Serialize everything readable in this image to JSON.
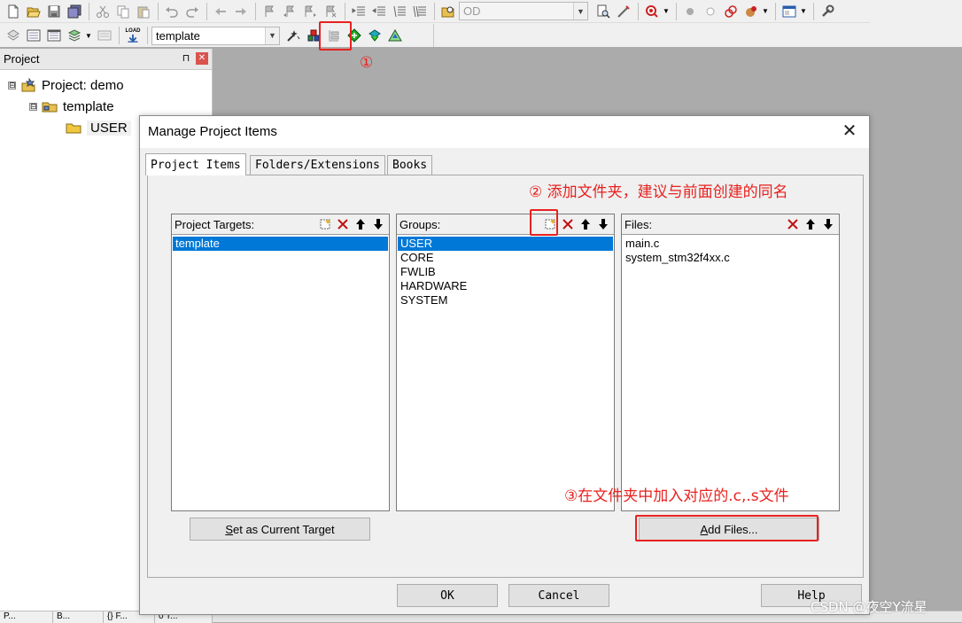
{
  "toolbar": {
    "row1_icons": [
      "new-file-icon",
      "open-folder-icon",
      "save-icon",
      "save-all-icon",
      "cut-icon",
      "copy-icon",
      "paste-icon",
      "undo-icon",
      "redo-icon",
      "nav-back-icon",
      "nav-forward-icon",
      "bookmark-icon",
      "bookmark-prev-icon",
      "bookmark-next-icon",
      "bookmark-clear-icon",
      "indent-icon",
      "unindent-icon",
      "comment-icon",
      "uncomment-icon",
      "find-in-files-icon"
    ],
    "find_combo_value": "OD",
    "row1_right_icons": [
      "find-icon",
      "incremental-find-icon",
      "debug-session-icon",
      "breakpoint-icon",
      "breakpoint-disable-icon",
      "breakpoint-clear-icon",
      "breakpoint-kill-icon",
      "window-layout-icon",
      "configure-icon"
    ],
    "row2_icons": [
      "translate-icon",
      "build-icon",
      "rebuild-icon",
      "batch-build-icon",
      "stop-build-icon",
      "download-icon"
    ],
    "download_label": "LOAD",
    "target_combo_value": "template",
    "row2_right_icons": [
      "target-options-icon",
      "manage-project-items-icon",
      "file-extensions-icon",
      "manage-run-time-icon",
      "select-software-packs-icon",
      "pack-installer-icon"
    ]
  },
  "project_panel": {
    "title": "Project",
    "pin_glyph": "⊓",
    "close_glyph": "✕",
    "tree": [
      {
        "label": "Project: demo",
        "expander": "⊟"
      },
      {
        "label": "template",
        "expander": "⊟"
      },
      {
        "label": "USER"
      }
    ]
  },
  "bottom_tabs": [
    "P...",
    "B...",
    "{} F...",
    "0 T..."
  ],
  "annotations": {
    "a1": "①",
    "a2": "② 添加文件夹，建议与前面创建的同名",
    "a3": "③在文件夹中加入对应的.c,.s文件"
  },
  "dialog": {
    "title": "Manage Project Items",
    "close_glyph": "✕",
    "tabs": [
      "Project Items",
      "Folders/Extensions",
      "Books"
    ],
    "targets": {
      "header": "Project Targets:",
      "items": [
        "template"
      ],
      "selected": 0
    },
    "groups": {
      "header": "Groups:",
      "items": [
        "USER",
        "CORE",
        "FWLIB",
        "HARDWARE",
        "SYSTEM"
      ],
      "selected": 0
    },
    "files": {
      "header": "Files:",
      "items": [
        "main.c",
        "system_stm32f4xx.c"
      ]
    },
    "set_current_target": {
      "mnemonic": "S",
      "rest": "et as Current Target"
    },
    "add_files": {
      "mnemonic": "A",
      "rest": "dd Files..."
    },
    "ok_label": "OK",
    "cancel_label": "Cancel",
    "help_label": "Help"
  },
  "watermark": "CSDN @夜空Y流星",
  "colors": {
    "annotation_red": "#e8211e",
    "selection_blue": "#0078d7",
    "workspace_gray": "#ababab"
  }
}
